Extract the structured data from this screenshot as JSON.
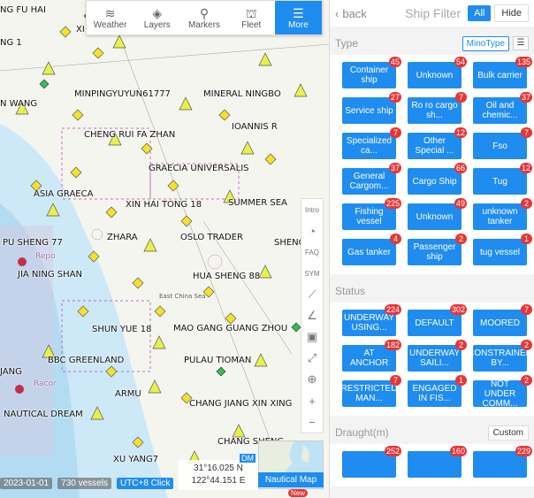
{
  "toolbar": {
    "items": [
      {
        "label": "Weather",
        "icon": "weather-icon"
      },
      {
        "label": "Layers",
        "icon": "layers-icon"
      },
      {
        "label": "Markers",
        "icon": "markers-icon"
      },
      {
        "label": "Fleet",
        "icon": "fleet-icon"
      },
      {
        "label": "More",
        "icon": "menu-icon"
      }
    ]
  },
  "map": {
    "ship_labels": [
      "NG FU HAI",
      "XI",
      "NG 1",
      "MINPINGYUYUN61777",
      "MINERAL NINGBO",
      "N WANG",
      "IOANNIS R",
      "CHENG RUI FA ZHAN",
      "GRAECIA UNIVERSALIS",
      "ASIA GRAECA",
      "XIN HAI TONG 18",
      "SUMMER SEA",
      "PU SHENG 77",
      "ZHARA",
      "OSLO TRADER",
      "SHENG",
      "JIA NING SHAN",
      "HUA SHENG 88",
      "SHUN YUE 18",
      "MAO GANG GUANG ZHOU",
      "BBC GREENLAND",
      "PULAU TIOMAN",
      "JANG",
      "ARMU",
      "CHANG JIANG XIN XING",
      "NAUTICAL DREAM",
      "CHANG SHENG",
      "XU YANG7"
    ],
    "chart_text": [
      "East China Sea",
      "Repo",
      "Racor"
    ],
    "side_tools": [
      "Intro",
      "FAQ",
      "SYM"
    ],
    "coordinates": {
      "lat": "31°16.025 N",
      "lon": "122°44.151 E"
    },
    "dm_label": "DM",
    "nautical_map_label": "Nautical Map",
    "new_badge": "New",
    "date": "2023-01-01",
    "vessel_count": "730 vessels",
    "timezone": "UTC+8 Click"
  },
  "panel": {
    "back_label": "back",
    "title": "Ship Filter",
    "all_label": "All",
    "hide_label": "Hide",
    "type_section": {
      "title": "Type",
      "mino_label": "MinoType",
      "chips": [
        {
          "label": "Container ship",
          "count": "45"
        },
        {
          "label": "Unknown",
          "count": "54"
        },
        {
          "label": "Bulk carrier",
          "count": "135"
        },
        {
          "label": "Service ship",
          "count": "27"
        },
        {
          "label": "Ro ro cargo sh...",
          "count": "7"
        },
        {
          "label": "Oil and chemic...",
          "count": "37"
        },
        {
          "label": "Specialized ca...",
          "count": "7"
        },
        {
          "label": "Other Special ...",
          "count": "12"
        },
        {
          "label": "Fso",
          "count": "7"
        },
        {
          "label": "General Cargom...",
          "count": "37"
        },
        {
          "label": "Cargo Ship",
          "count": "66"
        },
        {
          "label": "Tug",
          "count": "12"
        },
        {
          "label": "Fishing vessel",
          "count": "225"
        },
        {
          "label": "Unknown",
          "count": "49"
        },
        {
          "label": "unknown tanker",
          "count": "2"
        },
        {
          "label": "Gas tanker",
          "count": "4"
        },
        {
          "label": "Passenger ship",
          "count": "2"
        },
        {
          "label": "tug vessel",
          "count": "1"
        }
      ]
    },
    "status_section": {
      "title": "Status",
      "chips": [
        {
          "label": "UNDERWAY USING...",
          "count": "224"
        },
        {
          "label": "DEFAULT",
          "count": "302"
        },
        {
          "label": "MOORED",
          "count": "7"
        },
        {
          "label": "AT ANCHOR",
          "count": "182"
        },
        {
          "label": "UNDERWAY SAILI...",
          "count": "2"
        },
        {
          "label": "CONSTRAINED BY...",
          "count": "2"
        },
        {
          "label": "RESTRICTED MAN...",
          "count": "7"
        },
        {
          "label": "ENGAGED IN FIS...",
          "count": "1"
        },
        {
          "label": "NOT UNDER COMM...",
          "count": "2"
        }
      ]
    },
    "draught_section": {
      "title": "Draught(m)",
      "custom_label": "Custom",
      "chips": [
        {
          "label": "",
          "count": "252"
        },
        {
          "label": "",
          "count": "160"
        },
        {
          "label": "",
          "count": "229"
        }
      ]
    }
  }
}
